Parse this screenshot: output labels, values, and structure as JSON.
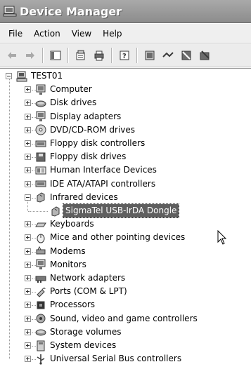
{
  "window": {
    "title": "Device Manager"
  },
  "menu": [
    "File",
    "Action",
    "View",
    "Help"
  ],
  "toolbar": [
    {
      "icon": "back-arrow-icon"
    },
    {
      "icon": "forward-arrow-icon"
    },
    {
      "sep": true
    },
    {
      "icon": "show-hide-console-tree-icon"
    },
    {
      "sep": true
    },
    {
      "icon": "properties-icon"
    },
    {
      "icon": "print-icon"
    },
    {
      "sep": true
    },
    {
      "icon": "help-icon"
    },
    {
      "sep": true
    },
    {
      "icon": "scan-hardware-icon"
    },
    {
      "icon": "update-driver-icon"
    },
    {
      "icon": "disable-device-icon"
    },
    {
      "icon": "uninstall-device-icon"
    }
  ],
  "tree": {
    "root": "TEST01",
    "categories": [
      {
        "label": "Computer",
        "icon": "computer-icon"
      },
      {
        "label": "Disk drives",
        "icon": "disk-drive-icon"
      },
      {
        "label": "Display adapters",
        "icon": "display-adapter-icon"
      },
      {
        "label": "DVD/CD-ROM drives",
        "icon": "dvd-drive-icon"
      },
      {
        "label": "Floppy disk controllers",
        "icon": "floppy-controller-icon"
      },
      {
        "label": "Floppy disk drives",
        "icon": "floppy-drive-icon"
      },
      {
        "label": "Human Interface Devices",
        "icon": "hid-icon"
      },
      {
        "label": "IDE ATA/ATAPI controllers",
        "icon": "ide-controller-icon"
      },
      {
        "label": "Infrared devices",
        "icon": "infrared-icon",
        "expanded": true,
        "children": [
          {
            "label": "SigmaTel USB-IrDA Dongle",
            "icon": "irda-dongle-icon",
            "selected": true
          }
        ]
      },
      {
        "label": "Keyboards",
        "icon": "keyboard-icon"
      },
      {
        "label": "Mice and other pointing devices",
        "icon": "mouse-icon"
      },
      {
        "label": "Modems",
        "icon": "modem-icon"
      },
      {
        "label": "Monitors",
        "icon": "monitor-icon"
      },
      {
        "label": "Network adapters",
        "icon": "network-adapter-icon"
      },
      {
        "label": "Ports (COM & LPT)",
        "icon": "port-icon"
      },
      {
        "label": "Processors",
        "icon": "processor-icon"
      },
      {
        "label": "Sound, video and game controllers",
        "icon": "sound-icon"
      },
      {
        "label": "Storage volumes",
        "icon": "storage-volume-icon"
      },
      {
        "label": "System devices",
        "icon": "system-device-icon"
      },
      {
        "label": "Universal Serial Bus controllers",
        "icon": "usb-icon"
      }
    ]
  }
}
